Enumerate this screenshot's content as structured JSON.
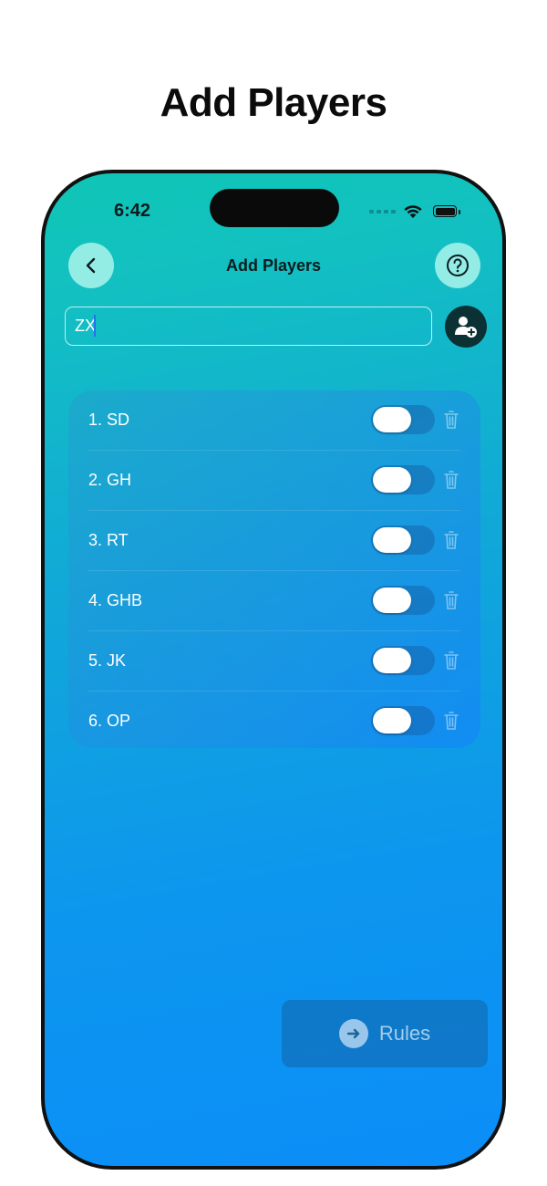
{
  "headline": "Add Players",
  "status_bar": {
    "time": "6:42"
  },
  "nav": {
    "title": "Add Players",
    "back_icon": "chevron-left-icon",
    "help_icon": "question-circle-icon"
  },
  "input": {
    "value": "ZX",
    "add_icon": "add-person-icon"
  },
  "players": [
    {
      "label": "1. SD",
      "enabled": false
    },
    {
      "label": "2. GH",
      "enabled": false
    },
    {
      "label": "3. RT",
      "enabled": false
    },
    {
      "label": "4. GHB",
      "enabled": false
    },
    {
      "label": "5. JK",
      "enabled": false
    },
    {
      "label": "6. OP",
      "enabled": false
    }
  ],
  "rules_button": {
    "label": "Rules",
    "icon": "arrow-right-circle-icon"
  },
  "colors": {
    "gradient_top": "#0fc6b5",
    "gradient_bottom": "#0b8ef8",
    "add_button_bg": "#0b3134"
  }
}
